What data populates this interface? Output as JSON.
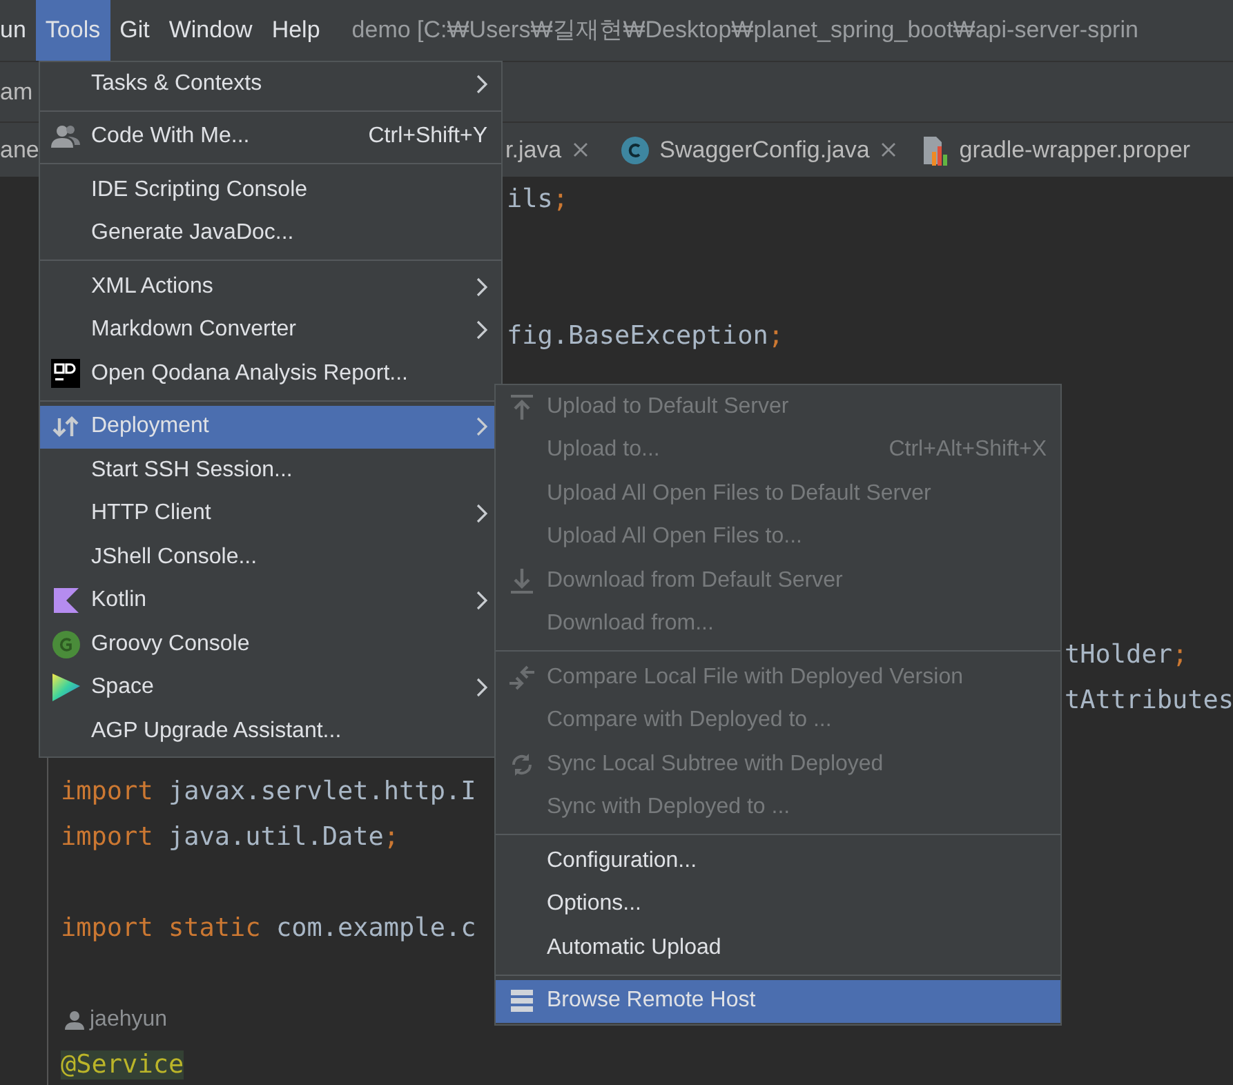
{
  "menu_bar": {
    "items": [
      {
        "label": "un",
        "selected": false
      },
      {
        "label": "Tools",
        "selected": true
      },
      {
        "label": "Git",
        "selected": false
      },
      {
        "label": "Window",
        "selected": false
      },
      {
        "label": "Help",
        "selected": false
      }
    ],
    "title": "demo [C:₩Users₩길재현₩Desktop₩planet_spring_boot₩api-server-sprin"
  },
  "navigation_bar": {
    "crumb": "am"
  },
  "tabs": [
    {
      "label": "ane",
      "selected": false,
      "closable": false
    },
    {
      "label": "r.java",
      "selected": false,
      "closable": true
    },
    {
      "label": "SwaggerConfig.java",
      "selected": false,
      "closable": true
    },
    {
      "label": "gradle-wrapper.proper",
      "selected": false,
      "closable": false
    }
  ],
  "code_lines": [
    {
      "kind": "code",
      "tokens": [
        {
          "kind": "plain",
          "text": "ils"
        },
        {
          "kind": "punct",
          "text": ";"
        }
      ]
    },
    {
      "kind": "blank"
    },
    {
      "kind": "blank"
    },
    {
      "kind": "code",
      "tokens": [
        {
          "kind": "plain",
          "text": "fig.BaseException"
        },
        {
          "kind": "punct",
          "text": ";"
        }
      ]
    },
    {
      "kind": "blank"
    },
    {
      "kind": "blank"
    },
    {
      "kind": "blank"
    },
    {
      "kind": "blank"
    },
    {
      "kind": "blank"
    },
    {
      "kind": "blank"
    },
    {
      "kind": "code",
      "tokens": [
        {
          "kind": "plain",
          "text": "tHolder"
        },
        {
          "kind": "punct",
          "text": ";"
        }
      ]
    },
    {
      "kind": "code",
      "tokens": [
        {
          "kind": "plain",
          "text": "tAttributes"
        }
      ]
    },
    {
      "kind": "blank"
    },
    {
      "kind": "code",
      "tokens": [
        {
          "kind": "keyword",
          "text": "import "
        },
        {
          "kind": "plain",
          "text": "javax.servlet.http.I"
        }
      ]
    },
    {
      "kind": "code",
      "tokens": [
        {
          "kind": "keyword",
          "text": "import "
        },
        {
          "kind": "plain",
          "text": "java.util.Date"
        },
        {
          "kind": "punct",
          "text": ";"
        }
      ]
    },
    {
      "kind": "blank"
    },
    {
      "kind": "code",
      "tokens": [
        {
          "kind": "keyword",
          "text": "import static "
        },
        {
          "kind": "plain",
          "text": "com.example.c"
        }
      ]
    },
    {
      "kind": "blank"
    },
    {
      "kind": "author",
      "text": "jaehyun"
    },
    {
      "kind": "code",
      "tokens": [
        {
          "kind": "annotation",
          "text": "@Service"
        }
      ]
    }
  ],
  "tools_menu": [
    {
      "kind": "item",
      "label": "Tasks & Contexts",
      "submenu": true,
      "selected": false
    },
    {
      "kind": "separator"
    },
    {
      "kind": "item",
      "label": "Code With Me...",
      "shortcut": "Ctrl+Shift+Y",
      "submenu": false,
      "selected": false
    },
    {
      "kind": "separator"
    },
    {
      "kind": "item",
      "label": "IDE Scripting Console",
      "submenu": false,
      "selected": false
    },
    {
      "kind": "item",
      "label": "Generate JavaDoc...",
      "submenu": false,
      "selected": false
    },
    {
      "kind": "separator"
    },
    {
      "kind": "item",
      "label": "XML Actions",
      "submenu": true,
      "selected": false
    },
    {
      "kind": "item",
      "label": "Markdown Converter",
      "submenu": true,
      "selected": false
    },
    {
      "kind": "item",
      "label": "Open Qodana Analysis Report...",
      "submenu": false,
      "selected": false
    },
    {
      "kind": "separator"
    },
    {
      "kind": "item",
      "label": "Deployment",
      "submenu": true,
      "selected": true
    },
    {
      "kind": "item",
      "label": "Start SSH Session...",
      "submenu": false,
      "selected": false
    },
    {
      "kind": "item",
      "label": "HTTP Client",
      "submenu": true,
      "selected": false
    },
    {
      "kind": "item",
      "label": "JShell Console...",
      "submenu": false,
      "selected": false
    },
    {
      "kind": "item",
      "label": "Kotlin",
      "submenu": true,
      "selected": false
    },
    {
      "kind": "item",
      "label": "Groovy Console",
      "submenu": false,
      "selected": false
    },
    {
      "kind": "item",
      "label": "Space",
      "submenu": true,
      "selected": false
    },
    {
      "kind": "item",
      "label": "AGP Upgrade Assistant...",
      "submenu": false,
      "selected": false
    }
  ],
  "deployment_menu": [
    {
      "kind": "item",
      "label": "Upload to Default Server",
      "disabled": true,
      "selected": false
    },
    {
      "kind": "item",
      "label": "Upload to...",
      "shortcut": "Ctrl+Alt+Shift+X",
      "disabled": true,
      "selected": false
    },
    {
      "kind": "item",
      "label": "Upload All Open Files to Default Server",
      "disabled": true,
      "selected": false
    },
    {
      "kind": "item",
      "label": "Upload All Open Files to...",
      "disabled": true,
      "selected": false
    },
    {
      "kind": "item",
      "label": "Download from Default Server",
      "disabled": true,
      "selected": false
    },
    {
      "kind": "item",
      "label": "Download from...",
      "disabled": true,
      "selected": false
    },
    {
      "kind": "separator"
    },
    {
      "kind": "item",
      "label": "Compare Local File with Deployed Version",
      "disabled": true,
      "selected": false
    },
    {
      "kind": "item",
      "label": "Compare with Deployed to ...",
      "disabled": true,
      "selected": false
    },
    {
      "kind": "item",
      "label": "Sync Local Subtree with Deployed",
      "disabled": true,
      "selected": false
    },
    {
      "kind": "item",
      "label": "Sync with Deployed to ...",
      "disabled": true,
      "selected": false
    },
    {
      "kind": "separator"
    },
    {
      "kind": "item",
      "label": "Configuration...",
      "disabled": false,
      "selected": false
    },
    {
      "kind": "item",
      "label": "Options...",
      "disabled": false,
      "selected": false
    },
    {
      "kind": "item",
      "label": "Automatic Upload",
      "disabled": false,
      "selected": false
    },
    {
      "kind": "separator"
    },
    {
      "kind": "item",
      "label": "Browse Remote Host",
      "disabled": false,
      "selected": true
    }
  ]
}
